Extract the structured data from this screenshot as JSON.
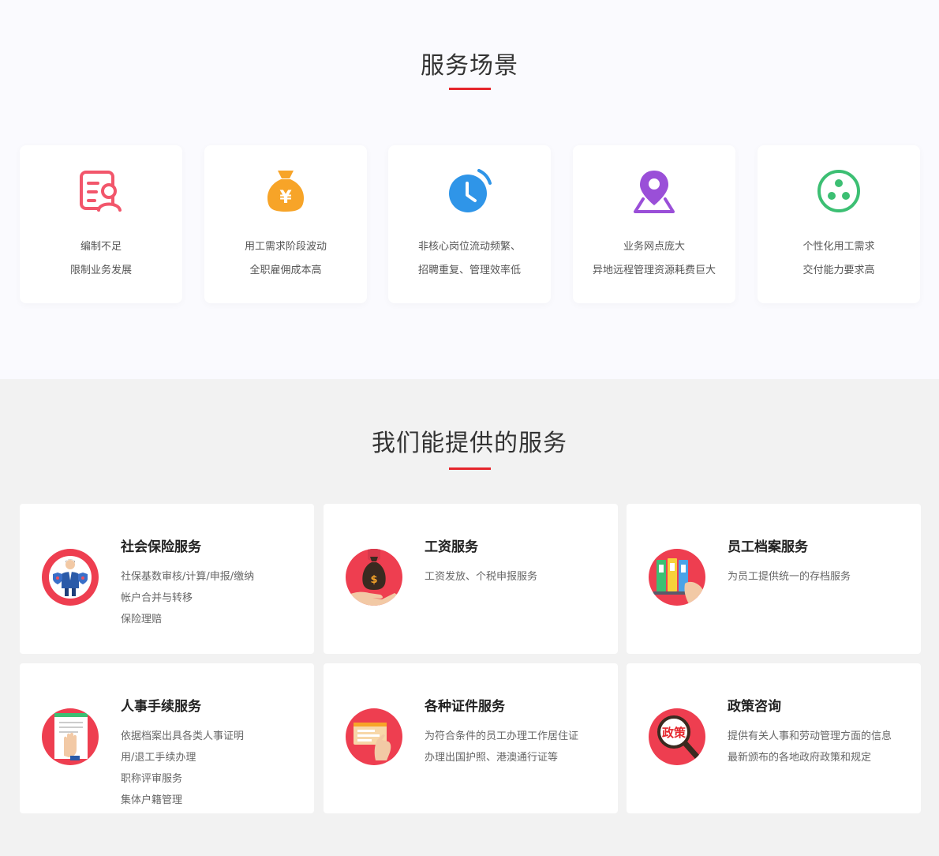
{
  "scenes": {
    "title": "服务场景",
    "cards": [
      {
        "icon": "id-card-person-icon",
        "color": "#f2566b",
        "line1": "编制不足",
        "line2": "限制业务发展"
      },
      {
        "icon": "money-bag-icon",
        "color": "#f7a428",
        "line1": "用工需求阶段波动",
        "line2": "全职雇佣成本高"
      },
      {
        "icon": "clock-icon",
        "color": "#2f95e8",
        "line1": "非核心岗位流动频繁、",
        "line2": "招聘重复、管理效率低"
      },
      {
        "icon": "map-pin-icon",
        "color": "#9a4fd8",
        "line1": "业务网点庞大",
        "line2": "异地远程管理资源耗费巨大"
      },
      {
        "icon": "three-dots-circle-icon",
        "color": "#3cbf73",
        "line1": "个性化用工需求",
        "line2": "交付能力要求高"
      }
    ]
  },
  "services": {
    "title": "我们能提供的服务",
    "cards": [
      {
        "icon": "insurance-person-icon",
        "title": "社会保险服务",
        "lines": [
          "社保基数审核/计算/申报/缴纳",
          "帐户合并与转移",
          "保险理赔"
        ]
      },
      {
        "icon": "salary-bag-icon",
        "title": "工资服务",
        "lines": [
          "工资发放、个税申报服务"
        ]
      },
      {
        "icon": "file-folders-icon",
        "title": "员工档案服务",
        "lines": [
          "为员工提供统一的存档服务"
        ]
      },
      {
        "icon": "document-hand-icon",
        "title": "人事手续服务",
        "lines": [
          "依据档案出具各类人事证明",
          "用/退工手续办理",
          "职称评审服务",
          "集体户籍管理"
        ]
      },
      {
        "icon": "certificate-card-icon",
        "title": "各种证件服务",
        "lines": [
          "为符合条件的员工办理工作居住证",
          "办理出国护照、港澳通行证等"
        ]
      },
      {
        "icon": "policy-magnifier-icon",
        "title": "政策咨询",
        "lines": [
          "提供有关人事和劳动管理方面的信息",
          "最新颁布的各地政府政策和规定"
        ],
        "badge": "政策"
      }
    ]
  }
}
